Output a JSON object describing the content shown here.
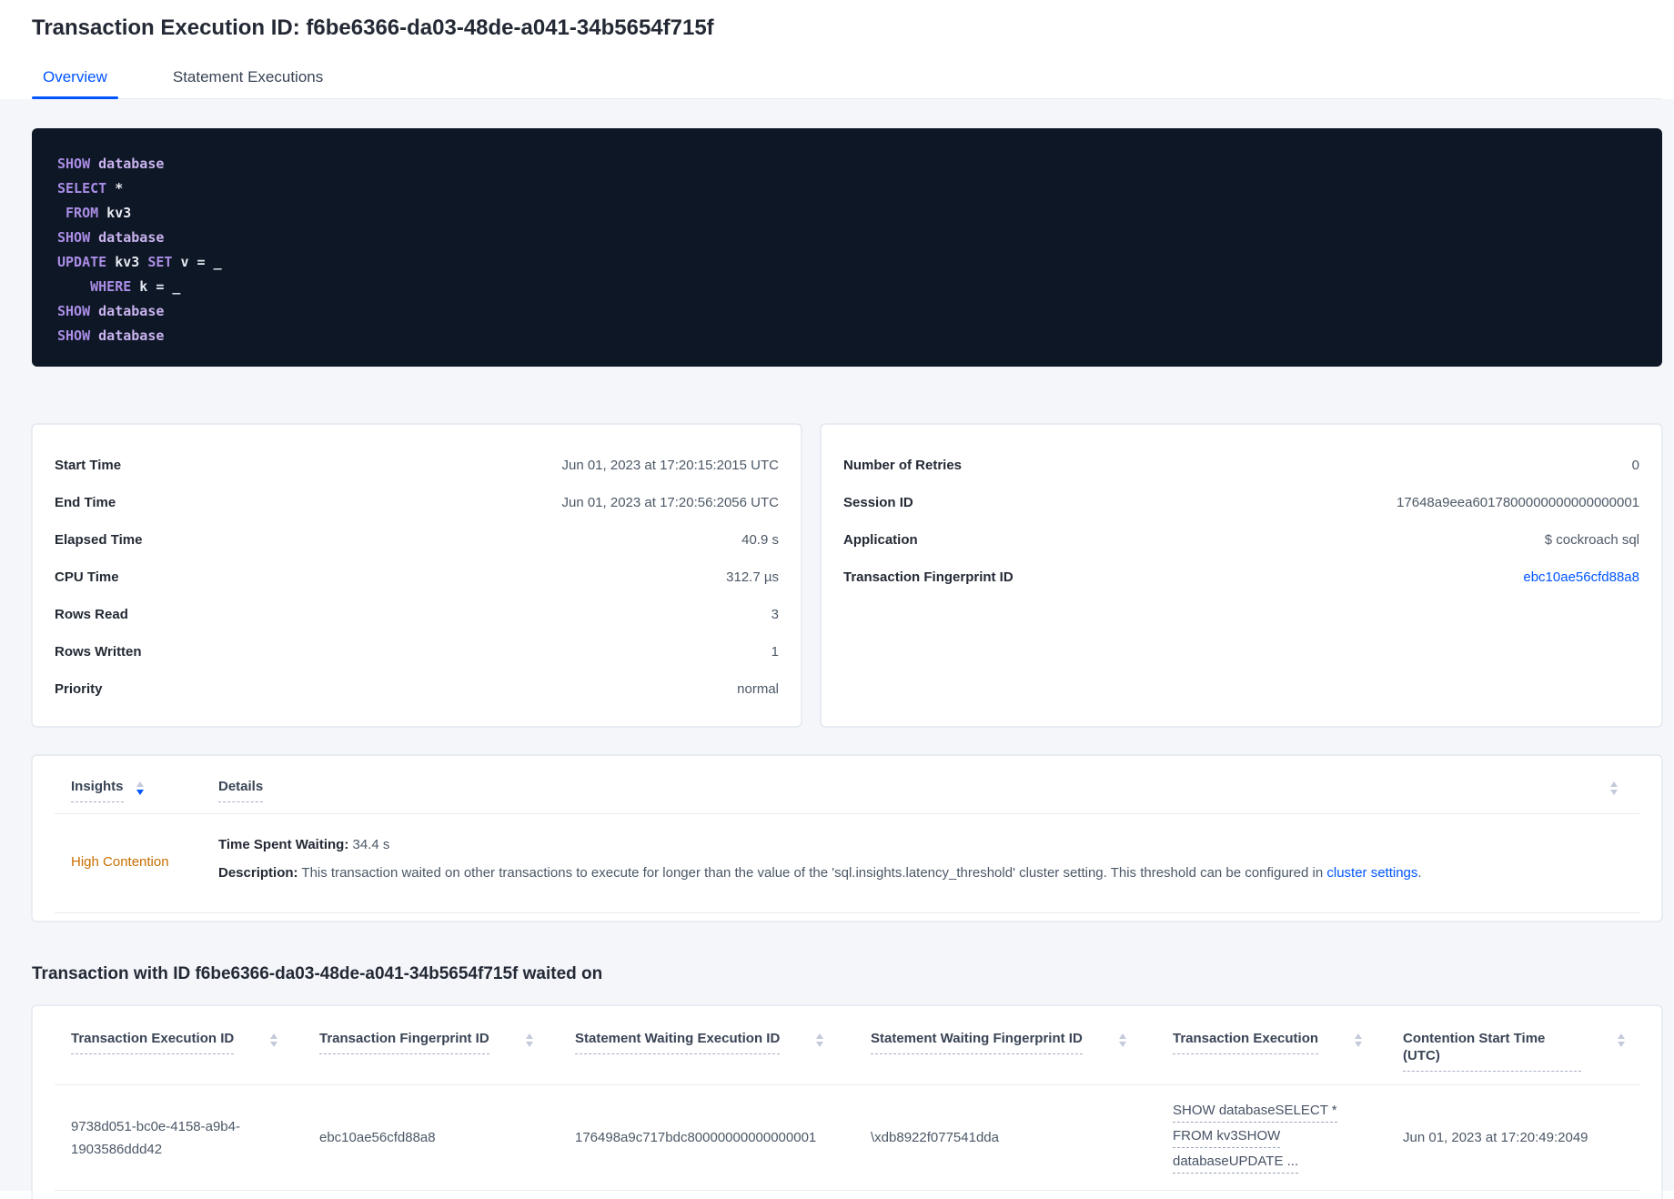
{
  "page_title": "Transaction Execution ID: f6be6366-da03-48de-a041-34b5654f715f",
  "tabs": {
    "overview": "Overview",
    "statement_executions": "Statement Executions"
  },
  "sql_code": {
    "lines": [
      [
        {
          "text": "SHOW",
          "cls": "kw"
        },
        {
          "text": " ",
          "cls": "plain"
        },
        {
          "text": "database",
          "cls": "ident"
        }
      ],
      [
        {
          "text": "SELECT",
          "cls": "kw"
        },
        {
          "text": " *",
          "cls": "plain"
        }
      ],
      [
        {
          "text": " ",
          "cls": "plain"
        },
        {
          "text": "FROM",
          "cls": "kw"
        },
        {
          "text": " kv3",
          "cls": "plain"
        }
      ],
      [
        {
          "text": "SHOW",
          "cls": "kw"
        },
        {
          "text": " ",
          "cls": "plain"
        },
        {
          "text": "database",
          "cls": "ident"
        }
      ],
      [
        {
          "text": "UPDATE",
          "cls": "kw"
        },
        {
          "text": " kv3 ",
          "cls": "plain"
        },
        {
          "text": "SET",
          "cls": "kw"
        },
        {
          "text": " v = _",
          "cls": "plain"
        }
      ],
      [
        {
          "text": "    ",
          "cls": "plain"
        },
        {
          "text": "WHERE",
          "cls": "kw"
        },
        {
          "text": " k = _",
          "cls": "plain"
        }
      ],
      [
        {
          "text": "SHOW",
          "cls": "kw"
        },
        {
          "text": " ",
          "cls": "plain"
        },
        {
          "text": "database",
          "cls": "ident"
        }
      ],
      [
        {
          "text": "SHOW",
          "cls": "kw"
        },
        {
          "text": " ",
          "cls": "plain"
        },
        {
          "text": "database",
          "cls": "ident"
        }
      ]
    ]
  },
  "summary_card": {
    "rows": [
      {
        "label": "Start Time",
        "value": "Jun 01, 2023 at 17:20:15:2015 UTC"
      },
      {
        "label": "End Time",
        "value": "Jun 01, 2023 at 17:20:56:2056 UTC"
      },
      {
        "label": "Elapsed Time",
        "value": "40.9 s"
      },
      {
        "label": "CPU Time",
        "value": "312.7 µs"
      },
      {
        "label": "Rows Read",
        "value": "3"
      },
      {
        "label": "Rows Written",
        "value": "1"
      },
      {
        "label": "Priority",
        "value": "normal"
      }
    ]
  },
  "meta_card": {
    "rows": [
      {
        "label": "Number of Retries",
        "value": "0"
      },
      {
        "label": "Session ID",
        "value": "17648a9eea6017800000000000000001"
      },
      {
        "label": "Application",
        "value": "$ cockroach sql"
      },
      {
        "label": "Transaction Fingerprint ID",
        "value": "ebc10ae56cfd88a8"
      }
    ]
  },
  "insights_table": {
    "insights_header": "Insights",
    "details_header": "Details",
    "row": {
      "insight": "High Contention",
      "time_waiting_label": "Time Spent Waiting:",
      "time_waiting_value": " 34.4 s",
      "description_label": "Description:",
      "description_text": " This transaction waited on other transactions to execute for longer than the value of the 'sql.insights.latency_threshold' cluster setting. This threshold can be configured in ",
      "description_link": "cluster settings",
      "description_period": "."
    }
  },
  "waited_section": {
    "heading": "Transaction with ID f6be6366-da03-48de-a041-34b5654f715f waited on",
    "columns": [
      "Transaction Execution ID",
      "Transaction Fingerprint ID",
      "Statement Waiting Execution ID",
      "Statement Waiting Fingerprint ID",
      "Transaction Execution",
      "Contention Start Time (UTC)"
    ],
    "row": {
      "transaction_execution_id": "9738d051-bc0e-4158-a9b4-1903586ddd42",
      "transaction_fingerprint_id": "ebc10ae56cfd88a8",
      "statement_waiting_execution_id": "176498a9c717bdc80000000000000001",
      "statement_waiting_fingerprint_id": "\\xdb8922f077541dda",
      "transaction_execution_lines": [
        "SHOW databaseSELECT *",
        "FROM kv3SHOW",
        "databaseUPDATE ..."
      ],
      "contention_start_time": "Jun 01, 2023 at 17:20:49:2049"
    }
  },
  "colors": {
    "accent_blue": "#0055ff",
    "warning_orange": "#c76e00",
    "code_background": "#0e1726",
    "page_background": "#f4f6fa"
  }
}
